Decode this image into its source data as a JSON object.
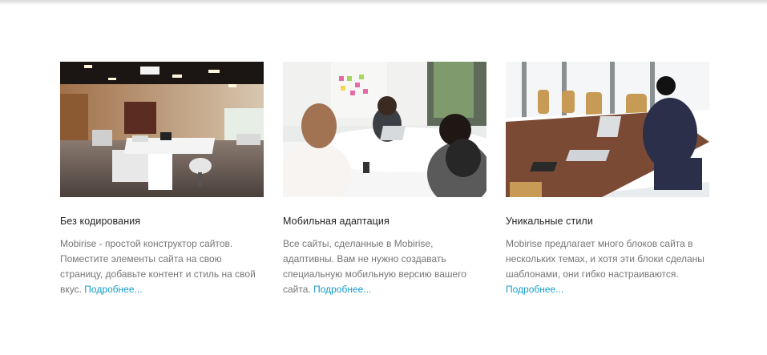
{
  "cards": [
    {
      "image_alt": "office-open-space",
      "title": "Без кодирования",
      "text": "Mobirise - простой конструктор сайтов. Поместите элементы сайта на свою страницу, добавьте контент и стиль на свой вкус.",
      "link": "Подробнее..."
    },
    {
      "image_alt": "team-meeting",
      "title": "Мобильная адаптация",
      "text": "Все сайты, сделанные в Mobirise, адаптивны. Вам не нужно создавать специальную мобильную версию вашего сайта.",
      "link": "Подробнее..."
    },
    {
      "image_alt": "conference-room",
      "title": "Уникальные стили",
      "text": "Mobirise предлагает много блоков сайта в нескольких темах, и хотя эти блоки сделаны шаблонами, они гибко настраиваются.",
      "link": "Подробнее..."
    }
  ],
  "colors": {
    "title": "#232323",
    "text": "#767676",
    "link": "#149dcc"
  }
}
